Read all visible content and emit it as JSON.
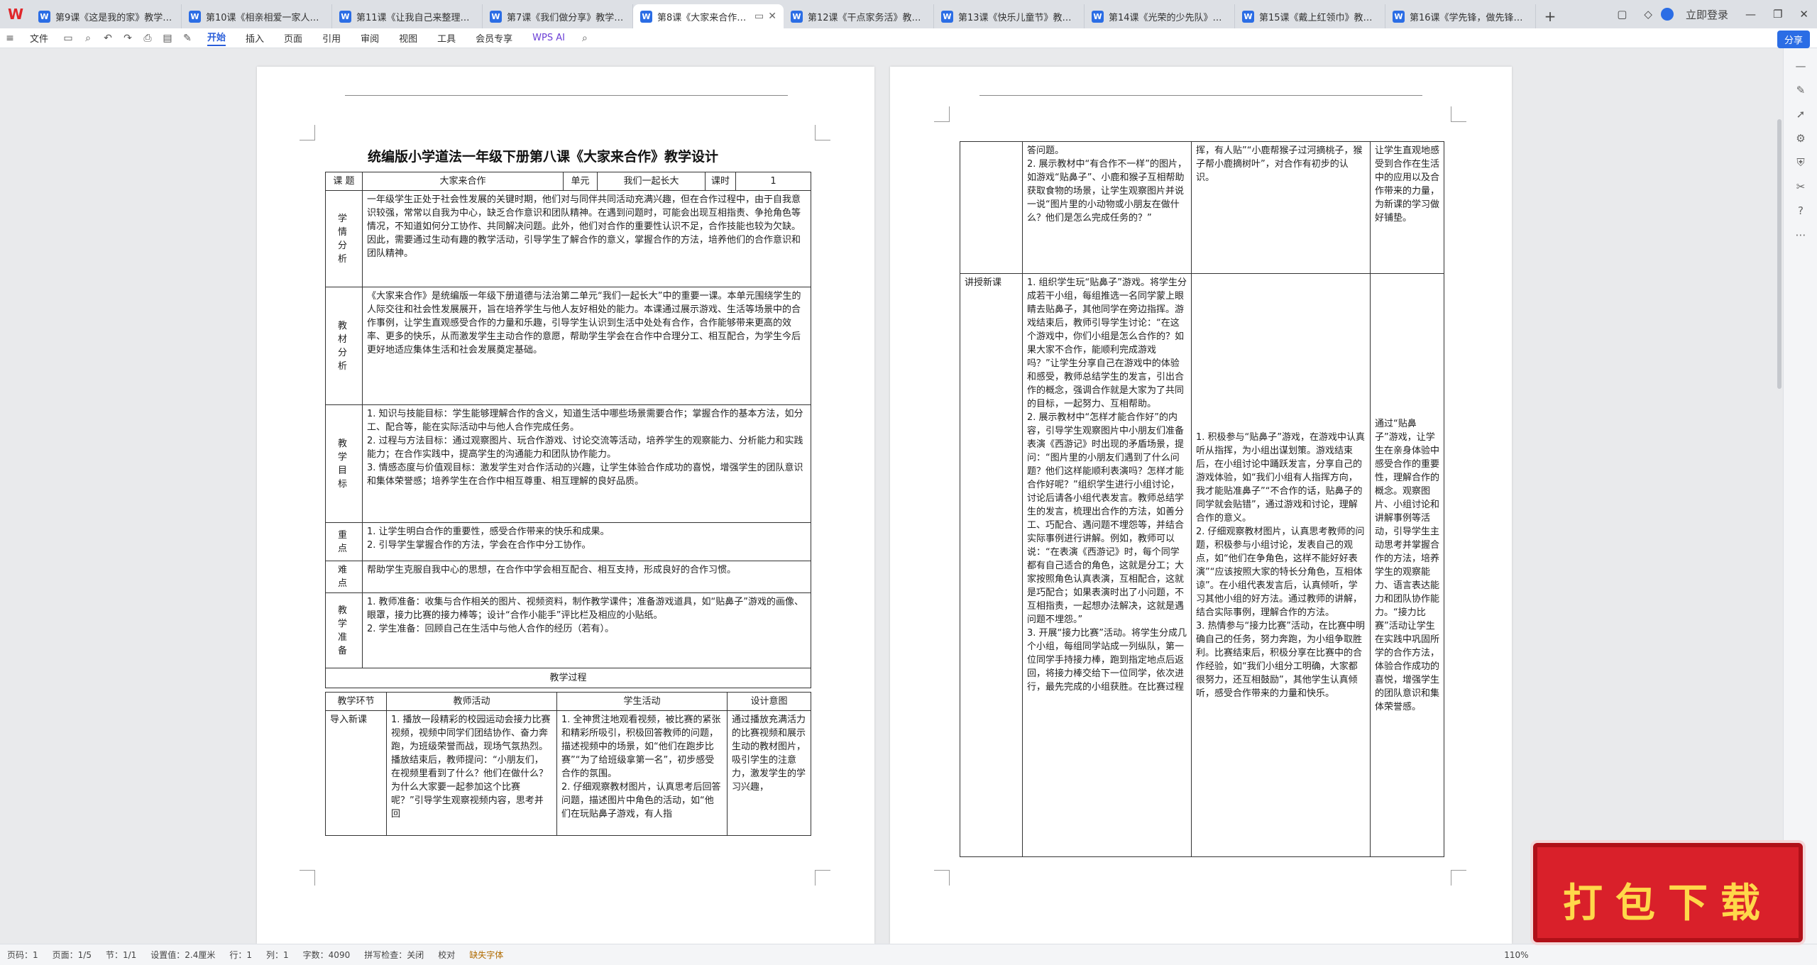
{
  "tabs": [
    {
      "title": "第9课《这是我的家》教学设计..."
    },
    {
      "title": "第10课《相亲相爱一家人》教学"
    },
    {
      "title": "第11课《让我自己来整理》教学"
    },
    {
      "title": "第7课《我们做分享》教学设计..."
    },
    {
      "title": "第8课《大家来合作》教"
    },
    {
      "title": "第12课《干点家务活》教学设计"
    },
    {
      "title": "第13课《快乐儿童节》教学设计..."
    },
    {
      "title": "第14课《光荣的少先队》教学设"
    },
    {
      "title": "第15课《戴上红领巾》教学设计"
    },
    {
      "title": "第16课《学先锋，做先锋》教学"
    }
  ],
  "login": "立即登录",
  "share": "分享",
  "menu": {
    "file": "文件",
    "items": [
      "开始",
      "插入",
      "页面",
      "引用",
      "审阅",
      "视图",
      "工具",
      "会员专享"
    ],
    "wps_ai": "WPS AI"
  },
  "doc": {
    "title": "统编版小学道法一年级下册第八课《大家来合作》教学设计",
    "t1": {
      "ke_ti_label": "课 题",
      "ke_ti": "大家来合作",
      "dan_yuan_label": "单元",
      "dan_yuan": "我们一起长大",
      "ke_shi_label": "课时",
      "ke_shi": "1",
      "xueqing_label": "学 情 分 析",
      "xueqing": "一年级学生正处于社会性发展的关键时期，他们对与同伴共同活动充满兴趣，但在合作过程中，由于自我意识较强，常常以自我为中心，缺乏合作意识和团队精神。在遇到问题时，可能会出现互相指责、争抢角色等情况，不知道如何分工协作、共同解决问题。此外，他们对合作的重要性认识不足，合作技能也较为欠缺。因此，需要通过生动有趣的教学活动，引导学生了解合作的意义，掌握合作的方法，培养他们的合作意识和团队精神。",
      "jiaocai_label": "教 材 分 析",
      "jiaocai": "《大家来合作》是统编版一年级下册道德与法治第二单元“我们一起长大”中的重要一课。本单元围绕学生的人际交往和社会性发展展开，旨在培养学生与他人友好相处的能力。本课通过展示游戏、生活等场景中的合作事例，让学生直观感受合作的力量和乐趣，引导学生认识到生活中处处有合作，合作能够带来更高的效率、更多的快乐，从而激发学生主动合作的意愿，帮助学生学会在合作中合理分工、相互配合，为学生今后更好地适应集体生活和社会发展奠定基础。",
      "mubiao_label": "教 学 目 标",
      "mubiao": [
        "1. 知识与技能目标：学生能够理解合作的含义，知道生活中哪些场景需要合作；掌握合作的基本方法，如分工、配合等，能在实际活动中与他人合作完成任务。",
        "2. 过程与方法目标：通过观察图片、玩合作游戏、讨论交流等活动，培养学生的观察能力、分析能力和实践能力；在合作实践中，提高学生的沟通能力和团队协作能力。",
        "3. 情感态度与价值观目标：激发学生对合作活动的兴趣，让学生体验合作成功的喜悦，增强学生的团队意识和集体荣誉感；培养学生在合作中相互尊重、相互理解的良好品质。"
      ],
      "zhongdian_label": "重 点",
      "zhongdian": [
        "1. 让学生明白合作的重要性，感受合作带来的快乐和成果。",
        "2. 引导学生掌握合作的方法，学会在合作中分工协作。"
      ],
      "nandian_label": "难 点",
      "nandian": "帮助学生克服自我中心的思想，在合作中学会相互配合、相互支持，形成良好的合作习惯。",
      "zhunbei_label": "教 学 准 备",
      "zhunbei": [
        "1. 教师准备：收集与合作相关的图片、视频资料，制作教学课件；准备游戏道具，如“贴鼻子”游戏的画像、眼罩，接力比赛的接力棒等；设计“合作小能手”评比栏及相应的小贴纸。",
        "2. 学生准备：回顾自己在生活中与他人合作的经历（若有）。"
      ],
      "process": "教学过程"
    },
    "t2": {
      "headers": [
        "教学环节",
        "教师活动",
        "学生活动",
        "设计意图"
      ],
      "row_label": "导入新课",
      "teacher": "1. 播放一段精彩的校园运动会接力比赛视频，视频中同学们团结协作、奋力奔跑，为班级荣誉而战，现场气氛热烈。播放结束后，教师提问：“小朋友们，在视频里看到了什么？他们在做什么？为什么大家要一起参加这个比赛呢？”引导学生观察视频内容，思考并回",
      "student": "1. 全神贯注地观看视频，被比赛的紧张和精彩所吸引，积极回答教师的问题，描述视频中的场景，如“他们在跑步比赛”“为了给班级拿第一名”，初步感受合作的氛围。\n2. 仔细观察教材图片，认真思考后回答问题，描述图片中角色的活动，如“他们在玩贴鼻子游戏，有人指",
      "intent": "通过播放充满活力的比赛视频和展示生动的教材图片，吸引学生的注意力，激发学生的学习兴趣，"
    },
    "t3": {
      "r1_teacher": "答问题。\n2. 展示教材中“有合作不一样”的图片，如游戏“贴鼻子”、小鹿和猴子互相帮助获取食物的场景，让学生观察图片并说一说“图片里的小动物或小朋友在做什么？他们是怎么完成任务的？”",
      "r1_student": "挥，有人贴”“小鹿帮猴子过河摘桃子，猴子帮小鹿摘树叶”，对合作有初步的认识。",
      "r1_intent": "让学生直观地感受到合作在生活中的应用以及合作带来的力量，为新课的学习做好铺垫。",
      "r2_label": "讲授新课",
      "r2_teacher": "1. 组织学生玩“贴鼻子”游戏。将学生分成若干小组，每组推选一名同学蒙上眼睛去贴鼻子，其他同学在旁边指挥。游戏结束后，教师引导学生讨论：“在这个游戏中，你们小组是怎么合作的？如果大家不合作，能顺利完成游戏吗？”让学生分享自己在游戏中的体验和感受，教师总结学生的发言，引出合作的概念，强调合作就是大家为了共同的目标，一起努力、互相帮助。\n2. 展示教材中“怎样才能合作好”的内容，引导学生观察图片中小朋友们准备表演《西游记》时出现的矛盾场景，提问：“图片里的小朋友们遇到了什么问题？他们这样能顺利表演吗？怎样才能合作好呢？”组织学生进行小组讨论，讨论后请各小组代表发言。教师总结学生的发言，梳理出合作的方法，如善分工、巧配合、遇问题不埋怨等，并结合实际事例进行讲解。例如，教师可以说：“在表演《西游记》时，每个同学都有自己适合的角色，这就是分工；大家按照角色认真表演，互相配合，这就是巧配合；如果表演时出了小问题，不互相指责，一起想办法解决，这就是遇问题不埋怨。”\n3. 开展“接力比赛”活动。将学生分成几个小组，每组同学站成一列纵队，第一位同学手持接力棒，跑到指定地点后返回，将接力棒交给下一位同学，依次进行，最先完成的小组获胜。在比赛过程",
      "r2_student": "1. 积极参与“贴鼻子”游戏，在游戏中认真听从指挥，为小组出谋划策。游戏结束后，在小组讨论中踊跃发言，分享自己的游戏体验，如“我们小组有人指挥方向，我才能贴准鼻子”“不合作的话，贴鼻子的同学就会贴错”，通过游戏和讨论，理解合作的意义。\n2. 仔细观察教材图片，认真思考教师的问题，积极参与小组讨论，发表自己的观点，如“他们在争角色，这样不能好好表演”“应该按照大家的特长分角色，互相体谅”。在小组代表发言后，认真倾听，学习其他小组的好方法。通过教师的讲解，结合实际事例，理解合作的方法。\n3. 热情参与“接力比赛”活动，在比赛中明确自己的任务，努力奔跑，为小组争取胜利。比赛结束后，积极分享在比赛中的合作经验，如“我们小组分工明确，大家都很努力，还互相鼓励”，其他学生认真倾听，感受合作带来的力量和快乐。",
      "r2_intent": "通过“贴鼻子”游戏，让学生在亲身体验中感受合作的重要性，理解合作的概念。观察图片、小组讨论和讲解事例等活动，引导学生主动思考并掌握合作的方法，培养学生的观察能力、语言表达能力和团队协作能力。“接力比赛”活动让学生在实践中巩固所学的合作方法，体验合作成功的喜悦，增强学生的团队意识和集体荣誉感。"
    }
  },
  "status": {
    "page": "页码：1",
    "pages": "页面：1/5",
    "section": "节：1/1",
    "setting": "设置值：2.4厘米",
    "row": "行：1",
    "col": "列：1",
    "words": "字数：4090",
    "spell": "拼写检查：关闭",
    "proof": "校对",
    "font_missing": "缺失字体",
    "zoom": "110%"
  },
  "download": "打包下载"
}
